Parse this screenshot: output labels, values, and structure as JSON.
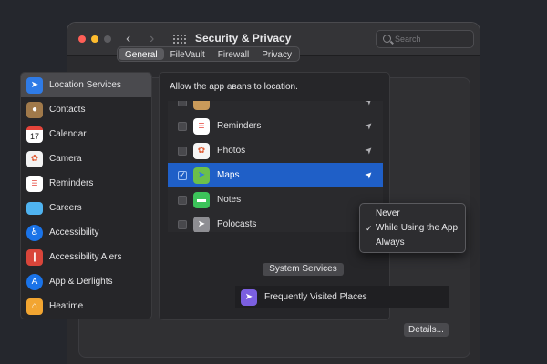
{
  "window": {
    "title": "Security & Privacy"
  },
  "search": {
    "placeholder": "Search"
  },
  "tabs": [
    {
      "label": "General",
      "active": true
    },
    {
      "label": "FileVault",
      "active": false
    },
    {
      "label": "Firewall",
      "active": false
    },
    {
      "label": "Privacy",
      "active": false
    }
  ],
  "sidebar": {
    "items": [
      {
        "label": "Location Services",
        "icon": "location-arrow-icon",
        "color": "#2f7be6",
        "selected": true
      },
      {
        "label": "Contacts",
        "icon": "contacts-book-icon",
        "color": "#a0794a"
      },
      {
        "label": "Calendar",
        "icon": "calendar-icon",
        "color": "#ffffff"
      },
      {
        "label": "Camera",
        "icon": "camera-icon",
        "color": "#e8e8e8"
      },
      {
        "label": "Reminders",
        "icon": "reminders-icon",
        "color": "#ffffff"
      },
      {
        "label": "Careers",
        "icon": "folder-icon",
        "color": "#4fb3f0"
      },
      {
        "label": "Accessibility",
        "icon": "accessibility-icon",
        "color": "#1a73e8"
      },
      {
        "label": "Accessibility Alers",
        "icon": "accessibility-alerts-icon",
        "color": "#d9453a"
      },
      {
        "label": "App & Derlights",
        "icon": "app-icon",
        "color": "#1a73e8"
      },
      {
        "label": "Heatime",
        "icon": "home-icon",
        "color": "#f2a531"
      }
    ]
  },
  "main": {
    "header": "Allow the app аваns to location.",
    "apps": [
      {
        "label": "",
        "icon": "partial-app-icon",
        "color": "#c99a5a",
        "checked": false,
        "partial": true
      },
      {
        "label": "Reminders",
        "icon": "reminders-icon",
        "color": "#ffffff",
        "checked": false
      },
      {
        "label": "Photos",
        "icon": "photos-icon",
        "color": "#f5f5f5",
        "checked": false
      },
      {
        "label": "Maps",
        "icon": "maps-icon",
        "color": "#6cc04a",
        "checked": true,
        "selected": true
      },
      {
        "label": "Notes",
        "icon": "notes-icon",
        "color": "#3cc35a",
        "checked": false
      },
      {
        "label": "Polocasts",
        "icon": "location-arrow-icon",
        "color": "#8e8e93",
        "checked": false
      }
    ],
    "system_services_label": "System Services",
    "frequent_label": "Frequently Visited Places",
    "details_label": "Details..."
  },
  "popup": {
    "items": [
      {
        "label": "Never",
        "checked": false
      },
      {
        "label": "While Using the App",
        "checked": true
      },
      {
        "label": "Always",
        "checked": false
      }
    ]
  },
  "colors": {
    "accent": "#1f5fc7",
    "background": "#25272d",
    "window": "#2b2b2e"
  },
  "glyphs": {
    "arrow": "➤",
    "check": "✓",
    "back": "‹",
    "fwd": "›"
  }
}
